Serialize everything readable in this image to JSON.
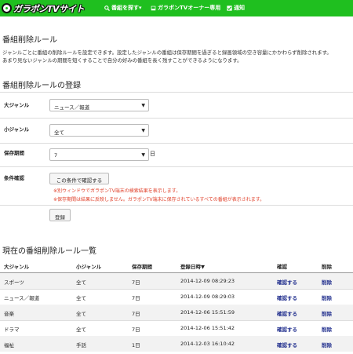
{
  "header": {
    "logo_text": "ガラポンTVサイト",
    "nav": [
      {
        "icon": "search-icon",
        "label": "番組を探す▾"
      },
      {
        "icon": "user-icon",
        "label": "ガラポンTVオーナー専用"
      },
      {
        "icon": "check-icon",
        "label": "通知"
      }
    ]
  },
  "page": {
    "title": "番組削除ルール",
    "desc_line1": "ジャンルごとに番組の削除ルールを設定できます。設定したジャンルの番組は保存期間を過ぎると録画領域の空き容量にかかわらず削除されます。",
    "desc_line2": "あまり見ないジャンルの期間を短くすることで自分の好みの番組を長く残すことができるようになります。"
  },
  "form": {
    "section_title": "番組削除ルールの登録",
    "main_genre_label": "大ジャンル",
    "main_genre_value": "ニュース／報道",
    "sub_genre_label": "小ジャンル",
    "sub_genre_value": "全て",
    "period_label": "保存期間",
    "period_value": "7",
    "period_suffix": "日",
    "confirm_label": "条件確認",
    "confirm_button": "この条件で確認する",
    "note1": "※別ウィンドウでガラポンTV端末の検索結果を表示します。",
    "note2": "※保存期間は結果に反映しません。ガラポンTV端末に保存されているすべての番組が表示されます。",
    "register_button": "登録"
  },
  "list": {
    "section_title": "現在の番組削除ルール一覧",
    "columns": [
      "大ジャンル",
      "小ジャンル",
      "保存期間",
      "登録日時▼",
      "確認",
      "削除"
    ],
    "rows": [
      [
        "スポーツ",
        "全て",
        "7日",
        "2014-12-09 08:29:23",
        "確認する",
        "削除"
      ],
      [
        "ニュース／報道",
        "全て",
        "7日",
        "2014-12-09 08:29:03",
        "確認する",
        "削除"
      ],
      [
        "音楽",
        "全て",
        "7日",
        "2014-12-06 15:51:59",
        "確認する",
        "削除"
      ],
      [
        "ドラマ",
        "全て",
        "7日",
        "2014-12-06 15:51:42",
        "確認する",
        "削除"
      ],
      [
        "福祉",
        "手話",
        "1日",
        "2014-12-03 16:10:42",
        "確認する",
        "削除"
      ]
    ]
  },
  "colors": {
    "brand_green": "#1fbf1f",
    "link_blue": "#1e2c8c",
    "note_red": "#e0412b"
  }
}
